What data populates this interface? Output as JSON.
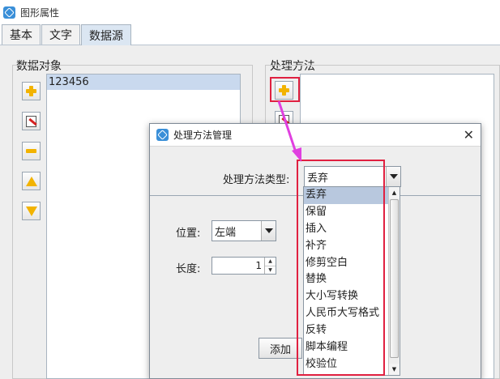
{
  "window": {
    "title": "图形属性"
  },
  "tabs": [
    {
      "label": "基本"
    },
    {
      "label": "文字"
    },
    {
      "label": "数据源"
    }
  ],
  "data_objects": {
    "label": "数据对象",
    "items": [
      "123456"
    ],
    "buttons": [
      "plus-icon",
      "edit-icon",
      "minus-icon",
      "arrow-up-icon",
      "arrow-down-icon"
    ]
  },
  "processing": {
    "label": "处理方法"
  },
  "dialog": {
    "title": "处理方法管理",
    "close": "✕",
    "type_label": "处理方法类型:",
    "type_value": "丢弃",
    "position_label": "位置:",
    "position_value": "左端",
    "length_label": "长度:",
    "length_value": "1",
    "add_label": "添加"
  },
  "dropdown": {
    "options": [
      "丢弃",
      "保留",
      "插入",
      "补齐",
      "修剪空白",
      "替换",
      "大小写转换",
      "人民币大写格式",
      "反转",
      "脚本编程",
      "校验位"
    ],
    "selected": "丢弃"
  },
  "colors": {
    "highlight": "#e02040",
    "arrow": "#e040e0"
  }
}
